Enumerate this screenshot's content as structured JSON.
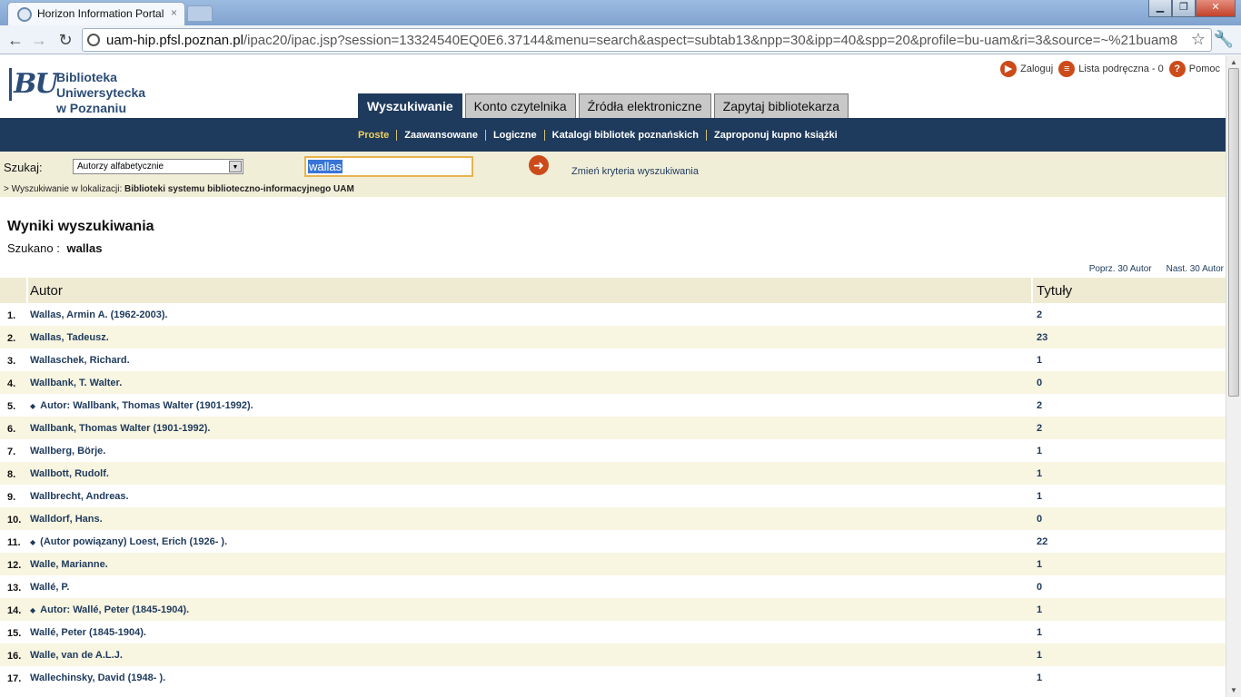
{
  "browser": {
    "tab_title": "Horizon Information Portal",
    "tab_close": "×",
    "url_host": "uam-hip.pfsl.poznan.pl",
    "url_path": "/ipac20/ipac.jsp?session=13324540EQ0E6.37144&menu=search&aspect=subtab13&npp=30&ipp=40&spp=20&profile=bu-uam&ri=3&source=~%21buam8",
    "icons": [
      "back-icon",
      "forward-icon",
      "reload-icon",
      "star-icon",
      "wrench-icon"
    ]
  },
  "logo": {
    "mark": "BU",
    "line1": "Biblioteka Uniwersytecka",
    "line2": "w Poznaniu"
  },
  "toplinks": {
    "login": "Zaloguj",
    "list": "Lista podręczna - 0",
    "help": "Pomoc"
  },
  "maintabs": [
    {
      "label": "Wyszukiwanie",
      "active": true
    },
    {
      "label": "Konto czytelnika",
      "active": false
    },
    {
      "label": "Źródła elektroniczne",
      "active": false
    },
    {
      "label": "Zapytaj bibliotekarza",
      "active": false
    }
  ],
  "subnav": [
    "Proste",
    "Zaawansowane",
    "Logiczne",
    "Katalogi bibliotek poznańskich",
    "Zaproponuj kupno książki"
  ],
  "search": {
    "label": "Szukaj:",
    "select_value": "Autorzy alfabetycznie",
    "query": "wallas",
    "change_link": "Zmień kryteria wyszukiwania",
    "location_prefix": "> Wyszukiwanie w lokalizacji:",
    "location": "Biblioteki systemu biblioteczno-informacyjnego UAM"
  },
  "results": {
    "title": "Wyniki wyszukiwania",
    "searched_label": "Szukano :",
    "searched_value": "wallas",
    "prev": "Poprz. 30 Autor",
    "next": "Nast. 30 Autor",
    "col_author": "Autor",
    "col_titles": "Tytuły",
    "rows": [
      {
        "num": "1.",
        "author": "Wallas, Armin A. (1962-2003).",
        "bullet": false,
        "count": "2"
      },
      {
        "num": "2.",
        "author": "Wallas, Tadeusz.",
        "bullet": false,
        "count": "23"
      },
      {
        "num": "3.",
        "author": "Wallaschek, Richard.",
        "bullet": false,
        "count": "1"
      },
      {
        "num": "4.",
        "author": "Wallbank, T. Walter.",
        "bullet": false,
        "count": "0"
      },
      {
        "num": "5.",
        "author": "Autor: Wallbank, Thomas Walter (1901-1992).",
        "bullet": true,
        "count": "2"
      },
      {
        "num": "6.",
        "author": "Wallbank, Thomas Walter (1901-1992).",
        "bullet": false,
        "count": "2"
      },
      {
        "num": "7.",
        "author": "Wallberg, Börje.",
        "bullet": false,
        "count": "1"
      },
      {
        "num": "8.",
        "author": "Wallbott, Rudolf.",
        "bullet": false,
        "count": "1"
      },
      {
        "num": "9.",
        "author": "Wallbrecht, Andreas.",
        "bullet": false,
        "count": "1"
      },
      {
        "num": "10.",
        "author": "Walldorf, Hans.",
        "bullet": false,
        "count": "0"
      },
      {
        "num": "11.",
        "author": "(Autor powiązany) Loest, Erich (1926- ).",
        "bullet": true,
        "count": "22"
      },
      {
        "num": "12.",
        "author": "Walle, Marianne.",
        "bullet": false,
        "count": "1"
      },
      {
        "num": "13.",
        "author": "Wallé, P.",
        "bullet": false,
        "count": "0"
      },
      {
        "num": "14.",
        "author": "Autor: Wallé, Peter (1845-1904).",
        "bullet": true,
        "count": "1"
      },
      {
        "num": "15.",
        "author": "Wallé, Peter (1845-1904).",
        "bullet": false,
        "count": "1"
      },
      {
        "num": "16.",
        "author": "Walle, van de A.L.J.",
        "bullet": false,
        "count": "1"
      },
      {
        "num": "17.",
        "author": "Wallechinsky, David (1948- ).",
        "bullet": false,
        "count": "1"
      }
    ]
  }
}
